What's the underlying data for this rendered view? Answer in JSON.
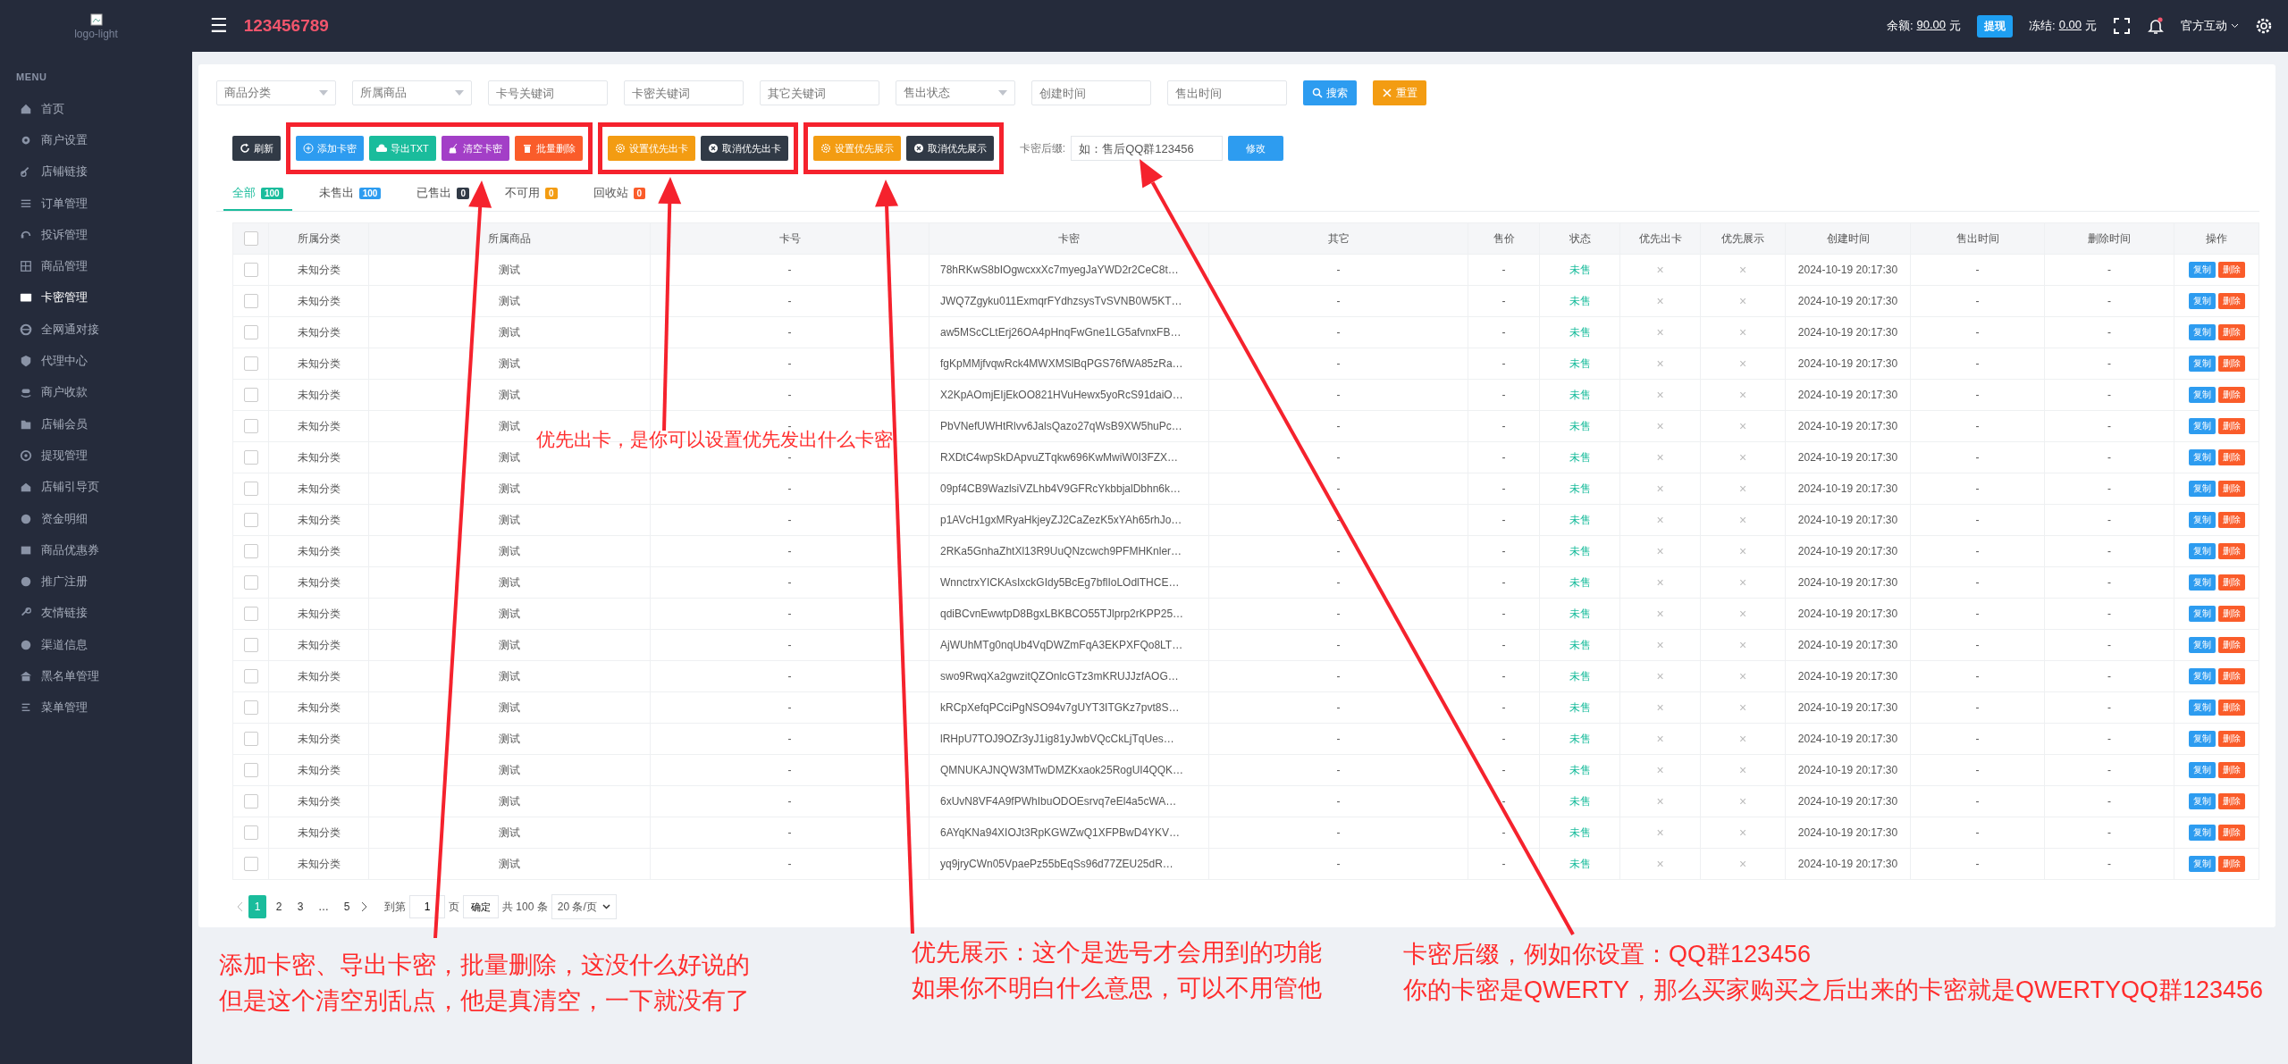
{
  "sidebar": {
    "logo_alt": "logo-light",
    "section": "MENU",
    "items": [
      {
        "label": "首页",
        "selected": false
      },
      {
        "label": "商户设置",
        "selected": false
      },
      {
        "label": "店铺链接",
        "selected": false
      },
      {
        "label": "订单管理",
        "selected": false
      },
      {
        "label": "投诉管理",
        "selected": false
      },
      {
        "label": "商品管理",
        "selected": false
      },
      {
        "label": "卡密管理",
        "selected": true
      },
      {
        "label": "全网通对接",
        "selected": false
      },
      {
        "label": "代理中心",
        "selected": false
      },
      {
        "label": "商户收款",
        "selected": false
      },
      {
        "label": "店铺会员",
        "selected": false
      },
      {
        "label": "提现管理",
        "selected": false
      },
      {
        "label": "店铺引导页",
        "selected": false
      },
      {
        "label": "资金明细",
        "selected": false
      },
      {
        "label": "商品优惠券",
        "selected": false
      },
      {
        "label": "推广注册",
        "selected": false
      },
      {
        "label": "友情链接",
        "selected": false
      },
      {
        "label": "渠道信息",
        "selected": false
      },
      {
        "label": "黑名单管理",
        "selected": false
      },
      {
        "label": "菜单管理",
        "selected": false
      }
    ]
  },
  "header": {
    "menu_icon": "☰",
    "account": "123456789",
    "balance_label": "余额:",
    "balance": "90.00",
    "balance_unit": "元",
    "withdraw": "提现",
    "frozen_label": "冻结:",
    "frozen": "0.00",
    "frozen_unit": "元",
    "user": "官方互动",
    "notification": true
  },
  "filters": [
    {
      "kind": "select",
      "placeholder": "商品分类"
    },
    {
      "kind": "select",
      "placeholder": "所属商品"
    },
    {
      "kind": "input",
      "placeholder": "卡号关键词"
    },
    {
      "kind": "input",
      "placeholder": "卡密关键词"
    },
    {
      "kind": "input",
      "placeholder": "其它关键词"
    },
    {
      "kind": "select",
      "placeholder": "售出状态"
    },
    {
      "kind": "input",
      "placeholder": "创建时间"
    },
    {
      "kind": "input",
      "placeholder": "售出时间"
    }
  ],
  "filter_buttons": [
    {
      "label": "搜索",
      "kind": "search"
    },
    {
      "label": "重置",
      "kind": "reset"
    }
  ],
  "actions": [
    {
      "label": "刷新",
      "kind": "refresh"
    },
    {
      "label": "添加卡密",
      "kind": "add"
    },
    {
      "label": "导出TXT",
      "kind": "export"
    },
    {
      "label": "清空卡密",
      "kind": "clear"
    },
    {
      "label": "批量删除",
      "kind": "delete"
    },
    {
      "label": "设置优先出卡",
      "kind": "set"
    },
    {
      "label": "取消优先出卡",
      "kind": "cancel"
    },
    {
      "label": "设置优先展示",
      "kind": "set"
    },
    {
      "label": "取消优先展示",
      "kind": "cancel"
    }
  ],
  "suffix": {
    "label": "卡密后缀:",
    "placeholder": "如：售后QQ群123456",
    "button": "修改"
  },
  "tabs": [
    {
      "label": "全部",
      "count": "100",
      "selected": true,
      "color": "#1abc9c"
    },
    {
      "label": "未售出",
      "count": "100",
      "selected": false,
      "color": "#2d9cf0"
    },
    {
      "label": "已售出",
      "count": "0",
      "selected": false,
      "color": "#313a46"
    },
    {
      "label": "不可用",
      "count": "0",
      "selected": false,
      "color": "#f39c12"
    },
    {
      "label": "回收站",
      "count": "0",
      "selected": false,
      "color": "#fa5c2a"
    }
  ],
  "table": {
    "select_all": {
      "checked": false
    },
    "columns": [
      "所属分类",
      "所属商品",
      "卡号",
      "卡密",
      "其它",
      "售价",
      "状态",
      "优先出卡",
      "优先展示",
      "创建时间",
      "售出时间",
      "删除时间",
      "操作"
    ],
    "rows": [
      {
        "category": "未知分类",
        "product": "测试",
        "card_no": "-",
        "secret": "78hRKwS8bIOgwcxxXc7myegJaYWD2r2CeC8t…",
        "other": "-",
        "price": "-",
        "status": "未售",
        "priority_out": "×",
        "priority_show": "×",
        "created": "2024-10-19 20:17:30",
        "sold": "-",
        "deleted": "-",
        "checked": false,
        "actions": [
          "复制",
          "删除"
        ]
      },
      {
        "category": "未知分类",
        "product": "测试",
        "card_no": "-",
        "secret": "JWQ7Zgyku011ExmqrFYdhzsysTvSVNB0W5KT…",
        "other": "-",
        "price": "-",
        "status": "未售",
        "priority_out": "×",
        "priority_show": "×",
        "created": "2024-10-19 20:17:30",
        "sold": "-",
        "deleted": "-",
        "checked": false,
        "actions": [
          "复制",
          "删除"
        ]
      },
      {
        "category": "未知分类",
        "product": "测试",
        "card_no": "-",
        "secret": "aw5MScCLtErj26OA4pHnqFwGne1LG5afvnxFB…",
        "other": "-",
        "price": "-",
        "status": "未售",
        "priority_out": "×",
        "priority_show": "×",
        "created": "2024-10-19 20:17:30",
        "sold": "-",
        "deleted": "-",
        "checked": false,
        "actions": [
          "复制",
          "删除"
        ]
      },
      {
        "category": "未知分类",
        "product": "测试",
        "card_no": "-",
        "secret": "fgKpMMjfvqwRck4MWXMSlBqPGS76fWA85zRa…",
        "other": "-",
        "price": "-",
        "status": "未售",
        "priority_out": "×",
        "priority_show": "×",
        "created": "2024-10-19 20:17:30",
        "sold": "-",
        "deleted": "-",
        "checked": false,
        "actions": [
          "复制",
          "删除"
        ]
      },
      {
        "category": "未知分类",
        "product": "测试",
        "card_no": "-",
        "secret": "X2KpAOmjEIjEkOO821HVuHewx5yoRcS91daiO…",
        "other": "-",
        "price": "-",
        "status": "未售",
        "priority_out": "×",
        "priority_show": "×",
        "created": "2024-10-19 20:17:30",
        "sold": "-",
        "deleted": "-",
        "checked": false,
        "actions": [
          "复制",
          "删除"
        ]
      },
      {
        "category": "未知分类",
        "product": "测试",
        "card_no": "-",
        "secret": "PbVNefUWHtRlvv6JalsQazo27qWsB9XW5huPc…",
        "other": "-",
        "price": "-",
        "status": "未售",
        "priority_out": "×",
        "priority_show": "×",
        "created": "2024-10-19 20:17:30",
        "sold": "-",
        "deleted": "-",
        "checked": false,
        "actions": [
          "复制",
          "删除"
        ]
      },
      {
        "category": "未知分类",
        "product": "测试",
        "card_no": "-",
        "secret": "RXDtC4wpSkDApvuZTqkw696KwMwiW0I3FZX…",
        "other": "-",
        "price": "-",
        "status": "未售",
        "priority_out": "×",
        "priority_show": "×",
        "created": "2024-10-19 20:17:30",
        "sold": "-",
        "deleted": "-",
        "checked": false,
        "actions": [
          "复制",
          "删除"
        ]
      },
      {
        "category": "未知分类",
        "product": "测试",
        "card_no": "-",
        "secret": "09pf4CB9WazlsiVZLhb4V9GFRcYkbbjalDbhn6k…",
        "other": "-",
        "price": "-",
        "status": "未售",
        "priority_out": "×",
        "priority_show": "×",
        "created": "2024-10-19 20:17:30",
        "sold": "-",
        "deleted": "-",
        "checked": false,
        "actions": [
          "复制",
          "删除"
        ]
      },
      {
        "category": "未知分类",
        "product": "测试",
        "card_no": "-",
        "secret": "p1AVcH1gxMRyaHkjeyZJ2CaZezK5xYAh65rhJo…",
        "other": "-",
        "price": "-",
        "status": "未售",
        "priority_out": "×",
        "priority_show": "×",
        "created": "2024-10-19 20:17:30",
        "sold": "-",
        "deleted": "-",
        "checked": false,
        "actions": [
          "复制",
          "删除"
        ]
      },
      {
        "category": "未知分类",
        "product": "测试",
        "card_no": "-",
        "secret": "2RKa5GnhaZhtXl13R9UuQNzcwch9PFMHKnler…",
        "other": "-",
        "price": "-",
        "status": "未售",
        "priority_out": "×",
        "priority_show": "×",
        "created": "2024-10-19 20:17:30",
        "sold": "-",
        "deleted": "-",
        "checked": false,
        "actions": [
          "复制",
          "删除"
        ]
      },
      {
        "category": "未知分类",
        "product": "测试",
        "card_no": "-",
        "secret": "WnnctrxYICKAsIxckGIdy5BcEg7bflIoLOdlTHCE…",
        "other": "-",
        "price": "-",
        "status": "未售",
        "priority_out": "×",
        "priority_show": "×",
        "created": "2024-10-19 20:17:30",
        "sold": "-",
        "deleted": "-",
        "checked": false,
        "actions": [
          "复制",
          "删除"
        ]
      },
      {
        "category": "未知分类",
        "product": "测试",
        "card_no": "-",
        "secret": "qdiBCvnEwwtpD8BgxLBKBCO55TJlprp2rKPP25…",
        "other": "-",
        "price": "-",
        "status": "未售",
        "priority_out": "×",
        "priority_show": "×",
        "created": "2024-10-19 20:17:30",
        "sold": "-",
        "deleted": "-",
        "checked": false,
        "actions": [
          "复制",
          "删除"
        ]
      },
      {
        "category": "未知分类",
        "product": "测试",
        "card_no": "-",
        "secret": "AjWUhMTg0nqUb4VqDWZmFqA3EKPXFQo8LT…",
        "other": "-",
        "price": "-",
        "status": "未售",
        "priority_out": "×",
        "priority_show": "×",
        "created": "2024-10-19 20:17:30",
        "sold": "-",
        "deleted": "-",
        "checked": false,
        "actions": [
          "复制",
          "删除"
        ]
      },
      {
        "category": "未知分类",
        "product": "测试",
        "card_no": "-",
        "secret": "swo9RwqXa2gwzitQZOnlcGTz3mKRUJJzfAOG…",
        "other": "-",
        "price": "-",
        "status": "未售",
        "priority_out": "×",
        "priority_show": "×",
        "created": "2024-10-19 20:17:30",
        "sold": "-",
        "deleted": "-",
        "checked": false,
        "actions": [
          "复制",
          "删除"
        ]
      },
      {
        "category": "未知分类",
        "product": "测试",
        "card_no": "-",
        "secret": "kRCpXefqPCciPgNSO94v7gUYT3ITGKz7pvt8S…",
        "other": "-",
        "price": "-",
        "status": "未售",
        "priority_out": "×",
        "priority_show": "×",
        "created": "2024-10-19 20:17:30",
        "sold": "-",
        "deleted": "-",
        "checked": false,
        "actions": [
          "复制",
          "删除"
        ]
      },
      {
        "category": "未知分类",
        "product": "测试",
        "card_no": "-",
        "secret": "lRHpU7TOJ9OZr3yJ1ig81yJwbVQcCkLjTqUes…",
        "other": "-",
        "price": "-",
        "status": "未售",
        "priority_out": "×",
        "priority_show": "×",
        "created": "2024-10-19 20:17:30",
        "sold": "-",
        "deleted": "-",
        "checked": false,
        "actions": [
          "复制",
          "删除"
        ]
      },
      {
        "category": "未知分类",
        "product": "测试",
        "card_no": "-",
        "secret": "QMNUKAJNQW3MTwDMZKxaok25RogUI4QQK…",
        "other": "-",
        "price": "-",
        "status": "未售",
        "priority_out": "×",
        "priority_show": "×",
        "created": "2024-10-19 20:17:30",
        "sold": "-",
        "deleted": "-",
        "checked": false,
        "actions": [
          "复制",
          "删除"
        ]
      },
      {
        "category": "未知分类",
        "product": "测试",
        "card_no": "-",
        "secret": "6xUvN8VF4A9fPWhIbuODOEsrvq7eEl4a5cWA…",
        "other": "-",
        "price": "-",
        "status": "未售",
        "priority_out": "×",
        "priority_show": "×",
        "created": "2024-10-19 20:17:30",
        "sold": "-",
        "deleted": "-",
        "checked": false,
        "actions": [
          "复制",
          "删除"
        ]
      },
      {
        "category": "未知分类",
        "product": "测试",
        "card_no": "-",
        "secret": "6AYqKNa94XIOJt3RpKGWZwQ1XFPBwD4YKV…",
        "other": "-",
        "price": "-",
        "status": "未售",
        "priority_out": "×",
        "priority_show": "×",
        "created": "2024-10-19 20:17:30",
        "sold": "-",
        "deleted": "-",
        "checked": false,
        "actions": [
          "复制",
          "删除"
        ]
      },
      {
        "category": "未知分类",
        "product": "测试",
        "card_no": "-",
        "secret": "yq9jryCWn05VpaePz55bEqSs96d77ZEU25dR…",
        "other": "-",
        "price": "-",
        "status": "未售",
        "priority_out": "×",
        "priority_show": "×",
        "created": "2024-10-19 20:17:30",
        "sold": "-",
        "deleted": "-",
        "checked": false,
        "actions": [
          "复制",
          "删除"
        ]
      }
    ]
  },
  "pagination": {
    "pages": [
      {
        "label": "1",
        "selected": true
      },
      {
        "label": "2",
        "selected": false
      },
      {
        "label": "3",
        "selected": false
      },
      {
        "label": "…",
        "selected": false
      },
      {
        "label": "5",
        "selected": false
      }
    ],
    "goto_label": "到第",
    "goto_value": "1",
    "page_unit": "页",
    "confirm": "确定",
    "total": "共 100 条",
    "page_size": "20 条/页"
  },
  "annotations": [
    {
      "lines": [
        "优先出卡，是你可以设置优先发出什么卡密"
      ]
    },
    {
      "lines": [
        "添加卡密、导出卡密，批量删除，这没什么好说的",
        "但是这个清空别乱点，他是真清空，一下就没有了"
      ]
    },
    {
      "lines": [
        "优先展示：这个是选号才会用到的功能",
        "如果你不明白什么意思，可以不用管他"
      ]
    },
    {
      "lines": [
        "卡密后缀，例如你设置：QQ群123456",
        "你的卡密是QWERTY，那么买家购买之后出来的卡密就是QWERTYQQ群123456"
      ]
    }
  ]
}
